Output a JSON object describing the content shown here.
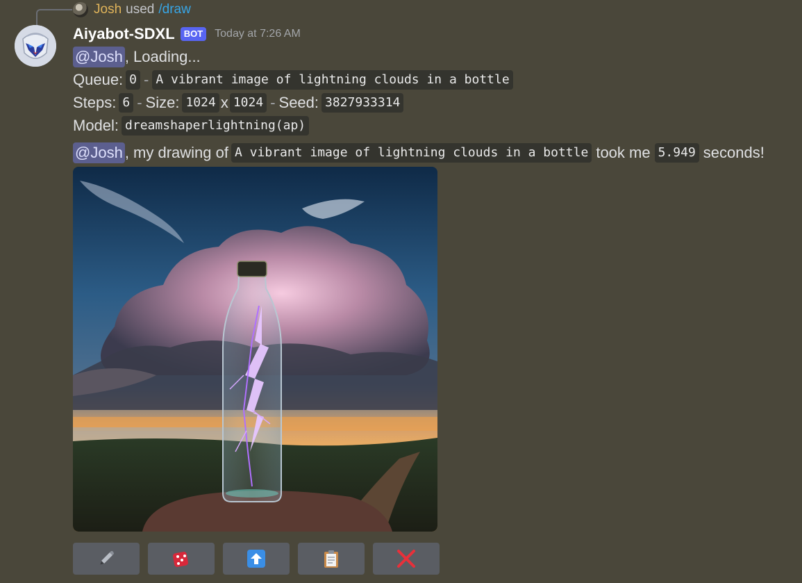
{
  "reply": {
    "username": "Josh",
    "used_text": "used",
    "command": "/draw"
  },
  "bot": {
    "name": "Aiyabot-SDXL",
    "tag": "BOT",
    "timestamp": "Today at 7:26 AM"
  },
  "message1": {
    "mention": "@Josh",
    "text": ", Loading...",
    "queue_label": "Queue:",
    "queue_value": "0",
    "dash": "-",
    "prompt": "A vibrant image of lightning clouds in a bottle",
    "steps_label": "Steps:",
    "steps_value": "6",
    "size_label": "Size:",
    "size_w": "1024",
    "size_x": "x",
    "size_h": "1024",
    "seed_label": "Seed:",
    "seed_value": "3827933314",
    "model_label": "Model:",
    "model_value": "dreamshaperlightning(ap)"
  },
  "message2": {
    "mention": "@Josh",
    "text_before": ", my drawing of",
    "prompt": "A vibrant image of lightning clouds in a bottle",
    "text_mid": "took me",
    "duration": "5.949",
    "text_after": "seconds!"
  },
  "buttons": [
    {
      "icon": "pencil-icon"
    },
    {
      "icon": "dice-icon"
    },
    {
      "icon": "upload-arrow-icon"
    },
    {
      "icon": "clipboard-icon"
    },
    {
      "icon": "close-icon"
    }
  ],
  "colors": {
    "background": "#4a473a",
    "mention_bg": "#5c5f8f",
    "bot_tag": "#5865f2",
    "username_reply": "#e0b45a",
    "command_link": "#38a6e6",
    "button_bg": "#5a5d63"
  }
}
